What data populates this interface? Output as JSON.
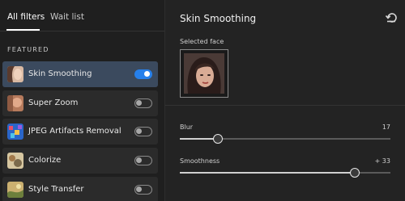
{
  "tabs": [
    {
      "label": "All filters",
      "active": true
    },
    {
      "label": "Wait list",
      "active": false
    }
  ],
  "section_label": "FEATURED",
  "filters": [
    {
      "label": "Skin Smoothing",
      "enabled": true,
      "selected": true
    },
    {
      "label": "Super Zoom",
      "enabled": false,
      "selected": false
    },
    {
      "label": "JPEG Artifacts Removal",
      "enabled": false,
      "selected": false
    },
    {
      "label": "Colorize",
      "enabled": false,
      "selected": false
    },
    {
      "label": "Style Transfer",
      "enabled": false,
      "selected": false
    }
  ],
  "panel": {
    "title": "Skin Smoothing",
    "reset_icon": "reset-icon",
    "selected_face_label": "Selected face",
    "sliders": {
      "blur": {
        "label": "Blur",
        "value": "17",
        "fraction": 0.18
      },
      "smoothness": {
        "label": "Smoothness",
        "value": "+ 33",
        "fraction": 0.83
      }
    }
  },
  "colors": {
    "accent": "#2680eb",
    "selected_item": "#3b4a5e"
  }
}
